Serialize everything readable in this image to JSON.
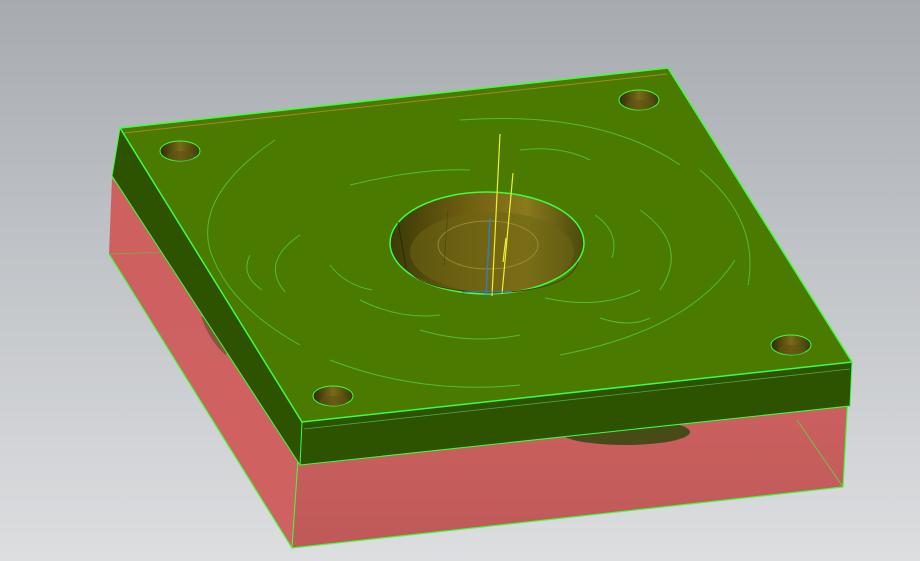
{
  "viewport": {
    "background_top": "#a7abb0",
    "background_bottom": "#dcdee0"
  },
  "model": {
    "top_plate": {
      "face_color": "#4a7a00",
      "side_color": "#2d5200",
      "edge_highlight_color": "#3dff3d",
      "mounting_holes": 4,
      "center_bore": 1
    },
    "bottom_block": {
      "color": "#d9605f",
      "transparent": true,
      "edge_color": "#3dff3d"
    },
    "feature_lines": {
      "curve_color": "#55c83a",
      "axis_colors": [
        "#f0f030",
        "#2f7de0"
      ]
    }
  }
}
